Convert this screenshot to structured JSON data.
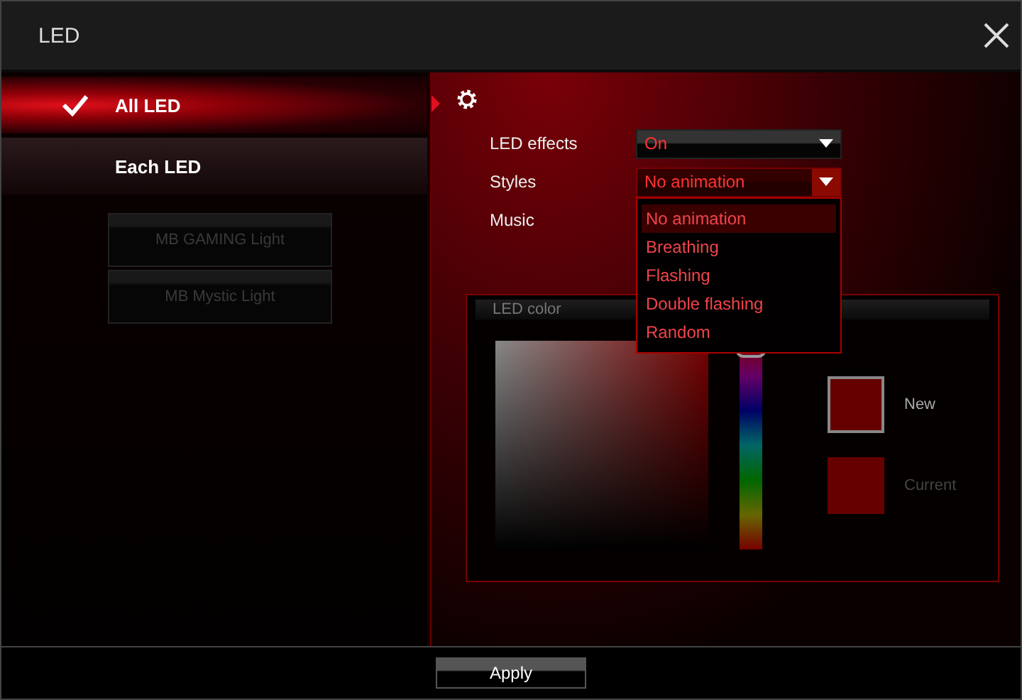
{
  "window": {
    "title": "LED"
  },
  "sidebar": {
    "items": [
      {
        "label": "All LED",
        "selected": true
      },
      {
        "label": "Each LED",
        "selected": false
      }
    ],
    "sub_buttons": [
      {
        "label": "MB GAMING Light",
        "disabled": true
      },
      {
        "label": "MB Mystic Light",
        "disabled": true
      }
    ]
  },
  "settings": {
    "rows": [
      {
        "kind": "dropdown",
        "label": "LED effects",
        "value": "On",
        "expanded": false
      },
      {
        "kind": "dropdown",
        "label": "Styles",
        "value": "No animation",
        "expanded": true,
        "options": [
          {
            "label": "No animation",
            "selected": true
          },
          {
            "label": "Breathing",
            "selected": false
          },
          {
            "label": "Flashing",
            "selected": false
          },
          {
            "label": "Double flashing",
            "selected": false
          },
          {
            "label": "Random",
            "selected": false
          }
        ]
      },
      {
        "kind": "label",
        "label": "Music"
      }
    ]
  },
  "led_color": {
    "title": "LED color",
    "hue_slider": {
      "level": 1
    },
    "new_label": "New",
    "current_label": "Current"
  },
  "footer": {
    "apply": "Apply"
  }
}
